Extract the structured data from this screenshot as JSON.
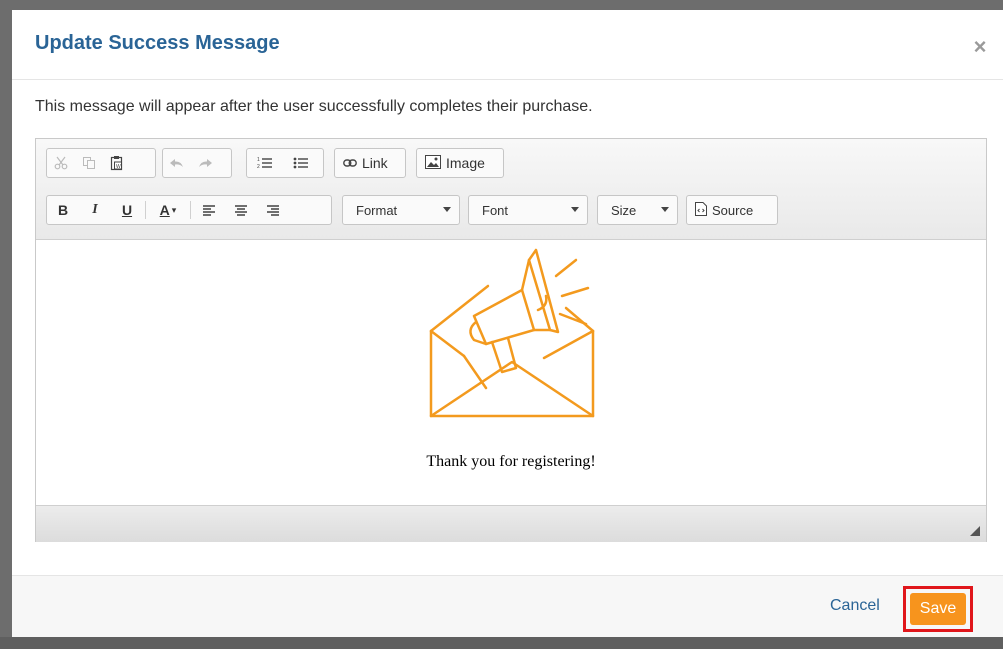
{
  "modal": {
    "title": "Update Success Message",
    "close_label": "×",
    "description": "This message will appear after the user successfully completes their purchase."
  },
  "toolbar": {
    "row1": {
      "cut_icon": "cut-icon",
      "copy_icon": "copy-icon",
      "paste_icon": "paste-icon",
      "undo_icon": "undo-icon",
      "redo_icon": "redo-icon",
      "numbered_list_icon": "numbered-list-icon",
      "bulleted_list_icon": "bulleted-list-icon",
      "link_label": "Link",
      "image_label": "Image"
    },
    "row2": {
      "bold": "B",
      "italic": "I",
      "underline": "U",
      "text_color": "A",
      "format_label": "Format",
      "font_label": "Font",
      "size_label": "Size",
      "source_label": "Source"
    }
  },
  "editor": {
    "message": "Thank you for registering!",
    "illustration": "envelope-megaphone-icon",
    "illustration_color": "#f39a1e"
  },
  "footer": {
    "cancel_label": "Cancel",
    "save_label": "Save",
    "save_color": "#f7941d",
    "highlight_color": "#e0161b"
  }
}
